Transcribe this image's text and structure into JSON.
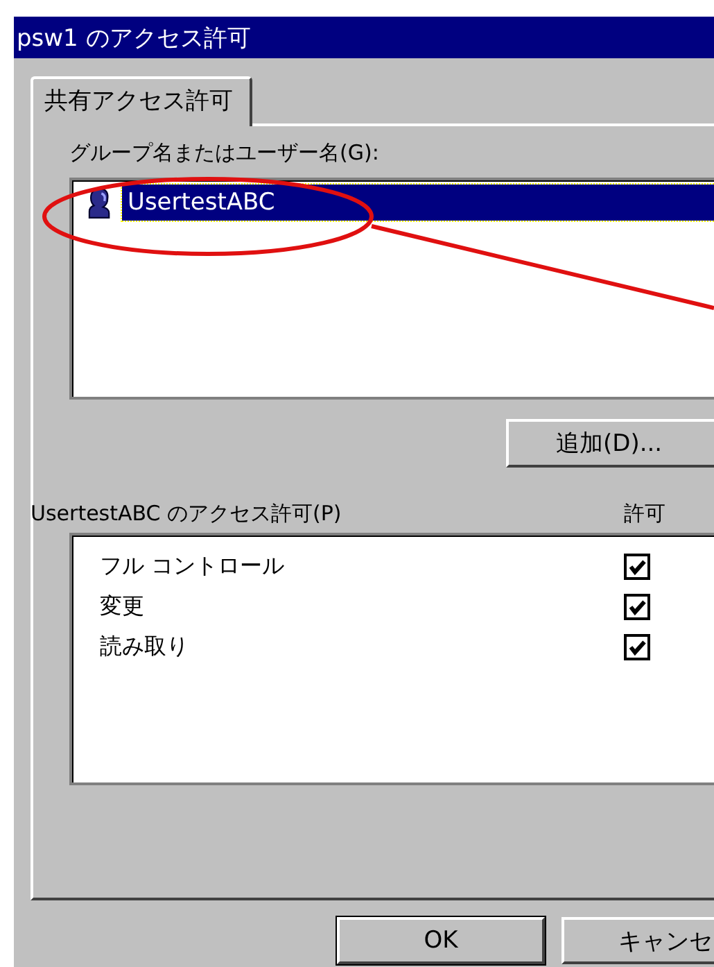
{
  "window": {
    "title": "psw1 のアクセス許可"
  },
  "tabs": [
    {
      "label": "共有アクセス許可",
      "selected": true
    }
  ],
  "users": {
    "label": "グループ名またはユーザー名(G):",
    "items": [
      {
        "name": "UsertestABC",
        "selected": true
      }
    ]
  },
  "add_button": "追加(D)...",
  "permissions": {
    "label": "UsertestABC のアクセス許可(P)",
    "column": "許可",
    "rows": [
      {
        "name": "フル コントロール",
        "checked": true
      },
      {
        "name": "変更",
        "checked": true
      },
      {
        "name": "読み取り",
        "checked": true
      }
    ]
  },
  "buttons": [
    "OK",
    "キャンセ"
  ]
}
